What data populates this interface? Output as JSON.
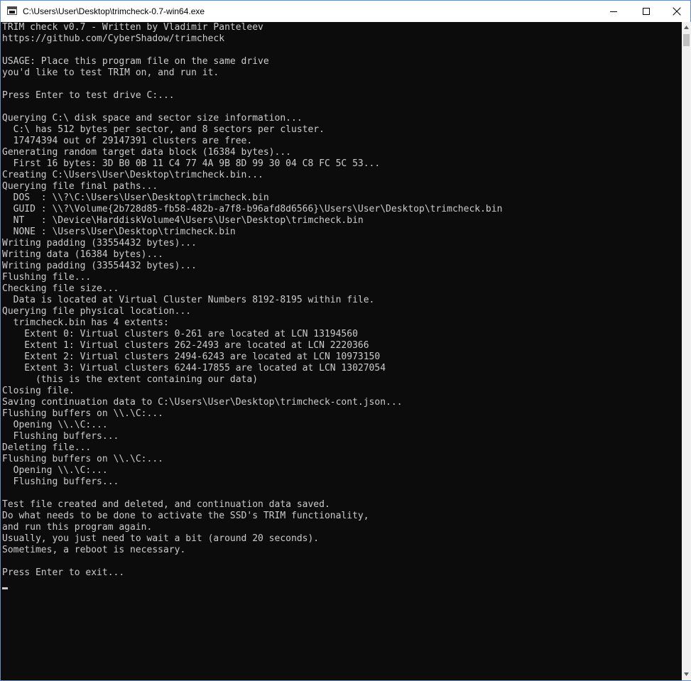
{
  "window": {
    "title": "C:\\Users\\User\\Desktop\\trimcheck-0.7-win64.exe",
    "icon": "console-app-icon",
    "controls": [
      "minimize-icon",
      "maximize-icon",
      "close-icon"
    ]
  },
  "console": {
    "lines": [
      "TRIM check v0.7 - Written by Vladimir Panteleev",
      "https://github.com/CyberShadow/trimcheck",
      "",
      "USAGE: Place this program file on the same drive",
      "you'd like to test TRIM on, and run it.",
      "",
      "Press Enter to test drive C:...",
      "",
      "Querying C:\\ disk space and sector size information...",
      "  C:\\ has 512 bytes per sector, and 8 sectors per cluster.",
      "  17474394 out of 29147391 clusters are free.",
      "Generating random target data block (16384 bytes)...",
      "  First 16 bytes: 3D B0 0B 11 C4 77 4A 9B 8D 99 30 04 C8 FC 5C 53...",
      "Creating C:\\Users\\User\\Desktop\\trimcheck.bin...",
      "Querying file final paths...",
      "  DOS  : \\\\?\\C:\\Users\\User\\Desktop\\trimcheck.bin",
      "  GUID : \\\\?\\Volume{2b728d85-fb58-482b-a7f8-b96afd8d6566}\\Users\\User\\Desktop\\trimcheck.bin",
      "  NT   : \\Device\\HarddiskVolume4\\Users\\User\\Desktop\\trimcheck.bin",
      "  NONE : \\Users\\User\\Desktop\\trimcheck.bin",
      "Writing padding (33554432 bytes)...",
      "Writing data (16384 bytes)...",
      "Writing padding (33554432 bytes)...",
      "Flushing file...",
      "Checking file size...",
      "  Data is located at Virtual Cluster Numbers 8192-8195 within file.",
      "Querying file physical location...",
      "  trimcheck.bin has 4 extents:",
      "    Extent 0: Virtual clusters 0-261 are located at LCN 13194560",
      "    Extent 1: Virtual clusters 262-2493 are located at LCN 2220366",
      "    Extent 2: Virtual clusters 2494-6243 are located at LCN 10973150",
      "    Extent 3: Virtual clusters 6244-17855 are located at LCN 13027054",
      "      (this is the extent containing our data)",
      "Closing file.",
      "Saving continuation data to C:\\Users\\User\\Desktop\\trimcheck-cont.json...",
      "Flushing buffers on \\\\.\\C:...",
      "  Opening \\\\.\\C:...",
      "  Flushing buffers...",
      "Deleting file...",
      "Flushing buffers on \\\\.\\C:...",
      "  Opening \\\\.\\C:...",
      "  Flushing buffers...",
      "",
      "Test file created and deleted, and continuation data saved.",
      "Do what needs to be done to activate the SSD's TRIM functionality,",
      "and run this program again.",
      "Usually, you just need to wait a bit (around 20 seconds).",
      "Sometimes, a reboot is necessary.",
      "",
      "Press Enter to exit..."
    ]
  },
  "colors": {
    "console_background": "#0c0c0c",
    "console_text": "#cccccc",
    "titlebar_background": "#ffffff",
    "window_border": "#6b8cb8"
  },
  "scrollbar": {
    "icons": [
      "scroll-up-arrow-icon",
      "scroll-down-arrow-icon"
    ]
  }
}
